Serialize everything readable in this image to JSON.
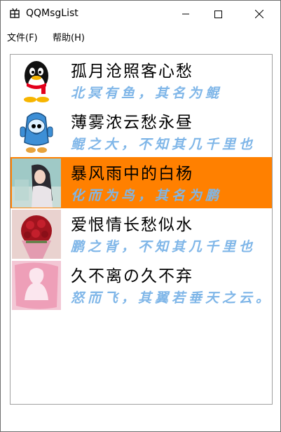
{
  "window": {
    "title": "QQMsgList"
  },
  "menu": {
    "items": [
      {
        "label": "文件(F)"
      },
      {
        "label": "帮助(H)"
      }
    ]
  },
  "list": {
    "items": [
      {
        "name": "孤月沧照客心愁",
        "message": "北冥有鱼，其名为鲲",
        "avatar": "penguin-avatar",
        "selected": false
      },
      {
        "name": "薄雾浓云愁永昼",
        "message": "鲲之大，不知其几千里也",
        "avatar": "blue-cartoon-avatar",
        "selected": false
      },
      {
        "name": "暴风雨中的白杨",
        "message": "化而为鸟，其名为鹏",
        "avatar": "girl-photo-avatar",
        "selected": true
      },
      {
        "name": "爱恨情长愁似水",
        "message": "鹏之背，不知其几千里也",
        "avatar": "flower-bouquet-avatar",
        "selected": false
      },
      {
        "name": "久不离の久不弃",
        "message": "怒而飞，其翼若垂天之云。",
        "avatar": "pink-silhouette-avatar",
        "selected": false
      }
    ],
    "selected_color": "#ff8000",
    "message_color": "#7fb6e8"
  }
}
